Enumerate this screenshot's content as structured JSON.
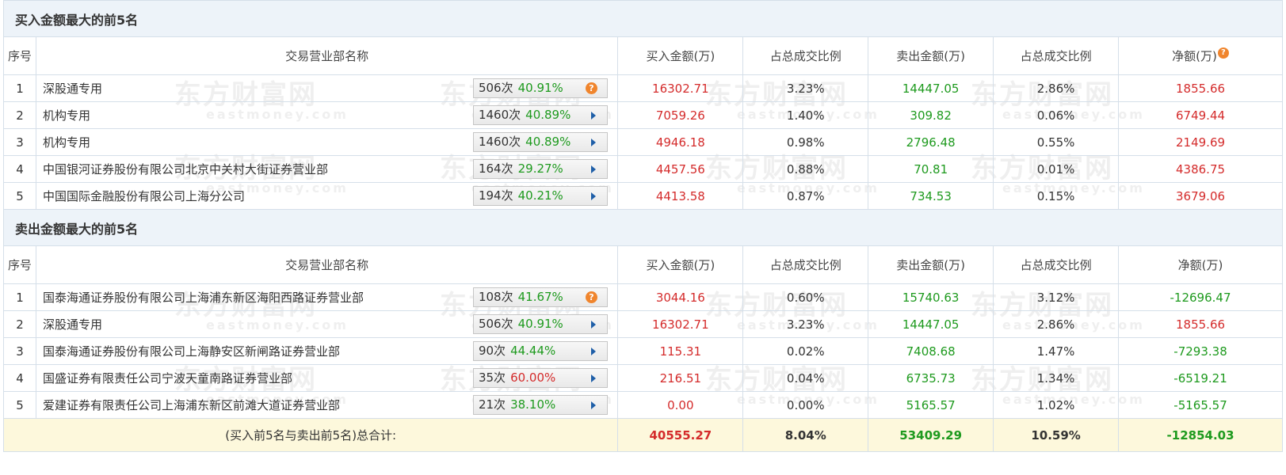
{
  "watermark": {
    "cn": "东方财富网",
    "en": "eastmoney.com"
  },
  "buy_section": {
    "title": "买入金额最大的前5名",
    "headers": [
      "序号",
      "交易营业部名称",
      "买入金额(万)",
      "占总成交比例",
      "卖出金额(万)",
      "占总成交比例",
      "净额(万)"
    ],
    "rows": [
      {
        "idx": "1",
        "name": "深股通专用",
        "count": "506次",
        "pct": "40.91%",
        "pct_color": "green",
        "marker": "question",
        "buy": "16302.71",
        "buy_ratio": "3.23%",
        "sell": "14447.05",
        "sell_ratio": "2.86%",
        "net": "1855.66"
      },
      {
        "idx": "2",
        "name": "机构专用",
        "count": "1460次",
        "pct": "40.89%",
        "pct_color": "green",
        "marker": "arrow",
        "buy": "7059.26",
        "buy_ratio": "1.40%",
        "sell": "309.82",
        "sell_ratio": "0.06%",
        "net": "6749.44"
      },
      {
        "idx": "3",
        "name": "机构专用",
        "count": "1460次",
        "pct": "40.89%",
        "pct_color": "green",
        "marker": "arrow",
        "buy": "4946.18",
        "buy_ratio": "0.98%",
        "sell": "2796.48",
        "sell_ratio": "0.55%",
        "net": "2149.69"
      },
      {
        "idx": "4",
        "name": "中国银河证券股份有限公司北京中关村大街证券营业部",
        "count": "164次",
        "pct": "29.27%",
        "pct_color": "green",
        "marker": "arrow",
        "buy": "4457.56",
        "buy_ratio": "0.88%",
        "sell": "70.81",
        "sell_ratio": "0.01%",
        "net": "4386.75"
      },
      {
        "idx": "5",
        "name": "中国国际金融股份有限公司上海分公司",
        "count": "194次",
        "pct": "40.21%",
        "pct_color": "green",
        "marker": "arrow",
        "buy": "4413.58",
        "buy_ratio": "0.87%",
        "sell": "734.53",
        "sell_ratio": "0.15%",
        "net": "3679.06"
      }
    ]
  },
  "sell_section": {
    "title": "卖出金额最大的前5名",
    "headers": [
      "序号",
      "交易营业部名称",
      "买入金额(万)",
      "占总成交比例",
      "卖出金额(万)",
      "占总成交比例",
      "净额(万)"
    ],
    "rows": [
      {
        "idx": "1",
        "name": "国泰海通证券股份有限公司上海浦东新区海阳西路证券营业部",
        "count": "108次",
        "pct": "41.67%",
        "pct_color": "green",
        "marker": "question",
        "buy": "3044.16",
        "buy_ratio": "0.60%",
        "sell": "15740.63",
        "sell_ratio": "3.12%",
        "net": "-12696.47"
      },
      {
        "idx": "2",
        "name": "深股通专用",
        "count": "506次",
        "pct": "40.91%",
        "pct_color": "green",
        "marker": "arrow",
        "buy": "16302.71",
        "buy_ratio": "3.23%",
        "sell": "14447.05",
        "sell_ratio": "2.86%",
        "net": "1855.66"
      },
      {
        "idx": "3",
        "name": "国泰海通证券股份有限公司上海静安区新闸路证券营业部",
        "count": "90次",
        "pct": "44.44%",
        "pct_color": "green",
        "marker": "arrow",
        "buy": "115.31",
        "buy_ratio": "0.02%",
        "sell": "7408.68",
        "sell_ratio": "1.47%",
        "net": "-7293.38"
      },
      {
        "idx": "4",
        "name": "国盛证券有限责任公司宁波天童南路证券营业部",
        "count": "35次",
        "pct": "60.00%",
        "pct_color": "red",
        "marker": "arrow",
        "buy": "216.51",
        "buy_ratio": "0.04%",
        "sell": "6735.73",
        "sell_ratio": "1.34%",
        "net": "-6519.21"
      },
      {
        "idx": "5",
        "name": "爱建证券有限责任公司上海浦东新区前滩大道证券营业部",
        "count": "21次",
        "pct": "38.10%",
        "pct_color": "green",
        "marker": "arrow",
        "buy": "0.00",
        "buy_ratio": "0.00%",
        "sell": "5165.57",
        "sell_ratio": "1.02%",
        "net": "-5165.57"
      }
    ]
  },
  "total": {
    "label": "(买入前5名与卖出前5名)总合计:",
    "buy": "40555.27",
    "buy_ratio": "8.04%",
    "sell": "53409.29",
    "sell_ratio": "10.59%",
    "net": "-12854.03"
  },
  "colors": {
    "positive": "#d42b2b",
    "negative": "#1e9a1e",
    "section_bg": "#edf3f9",
    "total_bg": "#fdf8dc",
    "border": "#d5dfe9"
  }
}
